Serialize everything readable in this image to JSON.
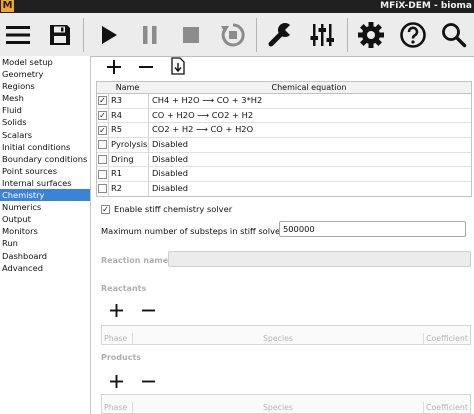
{
  "window": {
    "title": "MFiX-DEM - bioma",
    "logo_letter": "M"
  },
  "toolbar": {
    "buttons": [
      "menu",
      "save",
      "run",
      "pause",
      "stop",
      "reset",
      "build",
      "settings",
      "parameters",
      "help",
      "search"
    ]
  },
  "nav": {
    "items": [
      "Model setup",
      "Geometry",
      "Regions",
      "Mesh",
      "Fluid",
      "Solids",
      "Scalars",
      "Initial conditions",
      "Boundary conditions",
      "Point sources",
      "Internal surfaces",
      "Chemistry",
      "Numerics",
      "Output",
      "Monitors",
      "Run",
      "Dashboard",
      "Advanced"
    ],
    "selected_index": 11
  },
  "reactions": {
    "columns": [
      "Name",
      "Chemical equation"
    ],
    "rows": [
      {
        "checked": true,
        "name": "R3",
        "equation": "CH4 + H2O ⟶ CO + 3*H2"
      },
      {
        "checked": true,
        "name": "R4",
        "equation": "CO + H2O ⟶ CO2 + H2"
      },
      {
        "checked": true,
        "name": "R5",
        "equation": "CO2 + H2 ⟶ CO + H2O"
      },
      {
        "checked": false,
        "name": "Pyrolysis",
        "equation": "Disabled"
      },
      {
        "checked": false,
        "name": "Dring",
        "equation": "Disabled"
      },
      {
        "checked": false,
        "name": "R1",
        "equation": "Disabled"
      },
      {
        "checked": false,
        "name": "R2",
        "equation": "Disabled"
      }
    ]
  },
  "form": {
    "stiff_label": "Enable stiff chemistry solver",
    "stiff_checked": true,
    "substeps_label": "Maximum number of substeps in stiff solver",
    "substeps_value": "500000",
    "reaction_name_label": "Reaction name",
    "reaction_name_value": ""
  },
  "reactants": {
    "label": "Reactants",
    "columns": {
      "phase": "Phase",
      "species": "Species",
      "coefficient": "Coefficient"
    }
  },
  "products": {
    "label": "Products",
    "columns": {
      "phase": "Phase",
      "species": "Species",
      "coefficient": "Coefficient"
    }
  },
  "colors": {
    "accent": "#3a83d6",
    "title_bar": "#202020",
    "logo": "#f0a81e"
  }
}
